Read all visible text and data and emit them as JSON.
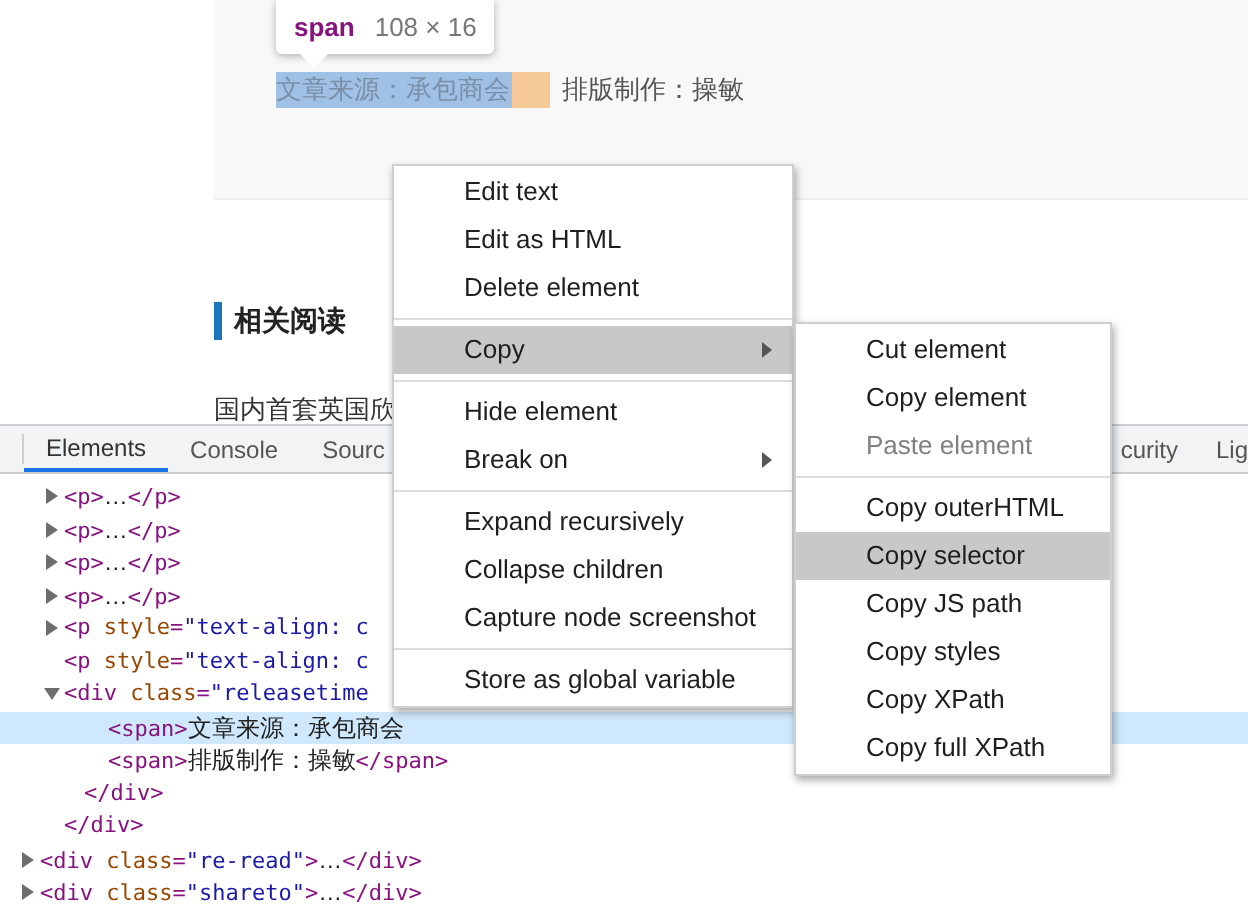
{
  "page": {
    "tooltip": {
      "tag": "span",
      "size": "108 × 16"
    },
    "meta": [
      {
        "text": "文章来源：承包商会",
        "kind": "highlighted"
      },
      {
        "text": "排版制作：操敏",
        "kind": "plain"
      }
    ],
    "heading": "相关阅读",
    "paragraph": "国内首套英国欣"
  },
  "devtools": {
    "tabs": [
      {
        "label": "Elements",
        "selected": true
      },
      {
        "label": "Console",
        "selected": false
      },
      {
        "label": "Sourc",
        "selected": false
      }
    ],
    "tabs_right": [
      "curity",
      "Lig"
    ],
    "lines": [
      {
        "expanded": false,
        "children": [
          {
            "kind": "tag",
            "text": "<p>"
          },
          {
            "kind": "text",
            "text": "…"
          },
          {
            "kind": "tag",
            "text": "</p>"
          }
        ]
      },
      {
        "expanded": false,
        "children": [
          {
            "kind": "tag",
            "text": "<p>"
          },
          {
            "kind": "text",
            "text": "…"
          },
          {
            "kind": "tag",
            "text": "</p>"
          }
        ]
      },
      {
        "expanded": false,
        "children": [
          {
            "kind": "tag",
            "text": "<p>"
          },
          {
            "kind": "text",
            "text": "…"
          },
          {
            "kind": "tag",
            "text": "</p>"
          }
        ]
      },
      {
        "expanded": false,
        "children": [
          {
            "kind": "tag",
            "text": "<p>"
          },
          {
            "kind": "text",
            "text": "…"
          },
          {
            "kind": "tag",
            "text": "</p>"
          }
        ]
      },
      {
        "expanded": false,
        "children": [
          {
            "kind": "tag",
            "text": "<p "
          },
          {
            "kind": "attr",
            "text": "style"
          },
          {
            "kind": "tag",
            "text": "="
          },
          {
            "kind": "value",
            "text": "\"text-align: c"
          }
        ]
      },
      {
        "children": [
          {
            "kind": "tag",
            "text": "<p "
          },
          {
            "kind": "attr",
            "text": "style"
          },
          {
            "kind": "tag",
            "text": "="
          },
          {
            "kind": "value",
            "text": "\"text-align: c"
          }
        ]
      },
      {
        "expanded": true,
        "children": [
          {
            "kind": "tag",
            "text": "<div "
          },
          {
            "kind": "attr",
            "text": "class"
          },
          {
            "kind": "tag",
            "text": "="
          },
          {
            "kind": "value",
            "text": "\"releasetime"
          }
        ]
      },
      {
        "selected": true,
        "children": [
          {
            "kind": "tag",
            "text": "<span>"
          },
          {
            "kind": "text",
            "text": "文章来源：承包商会"
          }
        ]
      },
      {
        "children": [
          {
            "kind": "tag",
            "text": "<span>"
          },
          {
            "kind": "text",
            "text": "排版制作：操敏"
          },
          {
            "kind": "tag",
            "text": "</span>"
          }
        ]
      },
      {
        "children": [
          {
            "kind": "tag",
            "text": "</div>"
          }
        ]
      },
      {
        "children": [
          {
            "kind": "tag",
            "text": "</div>"
          }
        ]
      },
      {
        "expanded": false,
        "children": [
          {
            "kind": "tag",
            "text": "<div "
          },
          {
            "kind": "attr",
            "text": "class"
          },
          {
            "kind": "tag",
            "text": "="
          },
          {
            "kind": "value",
            "text": "\"re-read\""
          },
          {
            "kind": "tag",
            "text": ">"
          },
          {
            "kind": "text",
            "text": "…"
          },
          {
            "kind": "tag",
            "text": "</div>"
          }
        ]
      },
      {
        "expanded": false,
        "children": [
          {
            "kind": "tag",
            "text": "<div "
          },
          {
            "kind": "attr",
            "text": "class"
          },
          {
            "kind": "tag",
            "text": "="
          },
          {
            "kind": "value",
            "text": "\"shareto\""
          },
          {
            "kind": "tag",
            "text": ">"
          },
          {
            "kind": "text",
            "text": "…"
          },
          {
            "kind": "tag",
            "text": "</div>"
          }
        ]
      }
    ]
  },
  "context_menu": [
    {
      "kind": "item",
      "label": "Edit text"
    },
    {
      "kind": "item",
      "label": "Edit as HTML"
    },
    {
      "kind": "item",
      "label": "Delete element"
    },
    {
      "kind": "separator"
    },
    {
      "kind": "item",
      "label": "Copy",
      "selected": true,
      "submenu": true
    },
    {
      "kind": "separator"
    },
    {
      "kind": "item",
      "label": "Hide element"
    },
    {
      "kind": "item",
      "label": "Break on",
      "submenu": true
    },
    {
      "kind": "separator"
    },
    {
      "kind": "item",
      "label": "Expand recursively"
    },
    {
      "kind": "item",
      "label": "Collapse children"
    },
    {
      "kind": "item",
      "label": "Capture node screenshot"
    },
    {
      "kind": "separator"
    },
    {
      "kind": "item",
      "label": "Store as global variable"
    }
  ],
  "submenu": [
    {
      "kind": "item",
      "label": "Cut element"
    },
    {
      "kind": "item",
      "label": "Copy element"
    },
    {
      "kind": "item",
      "label": "Paste element",
      "disabled": true
    },
    {
      "kind": "separator"
    },
    {
      "kind": "item",
      "label": "Copy outerHTML"
    },
    {
      "kind": "item",
      "label": "Copy selector",
      "selected": true
    },
    {
      "kind": "item",
      "label": "Copy JS path"
    },
    {
      "kind": "item",
      "label": "Copy styles"
    },
    {
      "kind": "item",
      "label": "Copy XPath"
    },
    {
      "kind": "item",
      "label": "Copy full XPath"
    }
  ]
}
